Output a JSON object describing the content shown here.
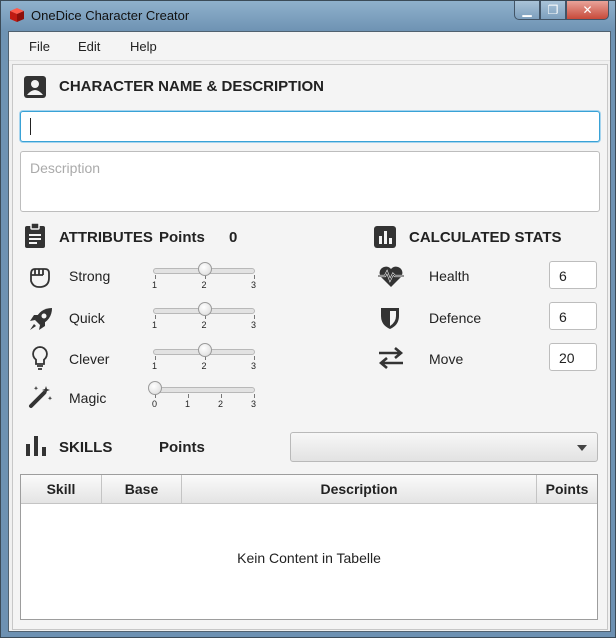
{
  "window": {
    "title": "OneDice Character Creator",
    "min_label": "▁",
    "max_label": "❐",
    "close_label": "✕"
  },
  "menu": {
    "file": "File",
    "edit": "Edit",
    "help": "Help"
  },
  "character": {
    "heading": "CHARACTER NAME & DESCRIPTION",
    "name_value": "",
    "description_placeholder": "Description"
  },
  "attributes": {
    "heading": "ATTRIBUTES",
    "points_label": "Points",
    "points_value": "0",
    "items": [
      {
        "label": "Strong",
        "icon": "fist-icon",
        "value": 2,
        "min": 1,
        "max": 3,
        "ticks": [
          "1",
          "2",
          "3"
        ]
      },
      {
        "label": "Quick",
        "icon": "rocket-icon",
        "value": 2,
        "min": 1,
        "max": 3,
        "ticks": [
          "1",
          "2",
          "3"
        ]
      },
      {
        "label": "Clever",
        "icon": "lightbulb-icon",
        "value": 2,
        "min": 1,
        "max": 3,
        "ticks": [
          "1",
          "2",
          "3"
        ]
      },
      {
        "label": "Magic",
        "icon": "magic-wand-icon",
        "value": 0,
        "min": 0,
        "max": 3,
        "ticks": [
          "0",
          "1",
          "2",
          "3"
        ]
      }
    ]
  },
  "stats": {
    "heading": "CALCULATED STATS",
    "items": [
      {
        "label": "Health",
        "icon": "heartbeat-icon",
        "value": "6"
      },
      {
        "label": "Defence",
        "icon": "shield-icon",
        "value": "6"
      },
      {
        "label": "Move",
        "icon": "arrows-exchange-icon",
        "value": "20"
      }
    ]
  },
  "skills": {
    "heading": "SKILLS",
    "points_label": "Points",
    "combo_value": "",
    "table": {
      "columns": [
        "Skill",
        "Base",
        "Description",
        "Points"
      ],
      "empty_text": "Kein Content in Tabelle"
    }
  },
  "colors": {
    "accent": "#39a2d6",
    "title_bar": "#6e93b3",
    "close": "#c74a3a"
  }
}
